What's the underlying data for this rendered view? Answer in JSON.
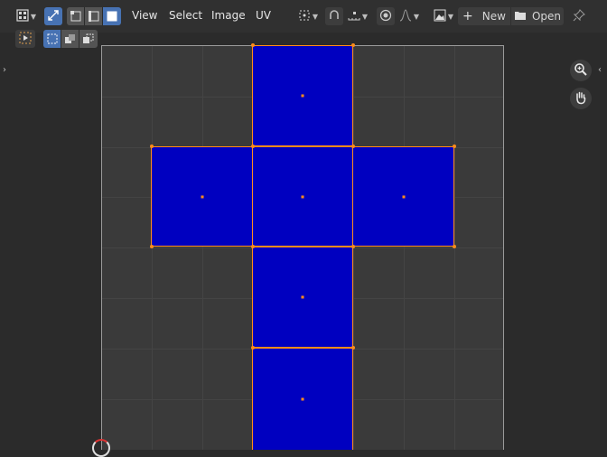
{
  "header": {
    "menus": {
      "view": "View",
      "select": "Select",
      "image": "Image",
      "uv": "UV"
    },
    "new_label": "New",
    "open_label": "Open",
    "plus_glyph": "+"
  },
  "colors": {
    "face_fill": "#0000c0",
    "selection": "#ff8c1a",
    "active_button": "#4772b3",
    "header_bg": "#303030",
    "viewport_bg": "#2b2b2b",
    "uv_area_bg": "#3a3a3a"
  },
  "icons": {
    "editor_type": "uv-editor-icon",
    "sync_selection": "sync-selection-icon",
    "select_vertex": "vertex-select-icon",
    "select_edge": "edge-select-icon",
    "select_face": "face-select-icon",
    "pivot": "pivot-icon",
    "snap": "snap-icon",
    "snap_increment": "snap-increment-icon",
    "proportional": "proportional-editing-icon",
    "falloff": "falloff-curve-icon",
    "image_browse": "image-browse-icon",
    "pin": "pin-icon",
    "zoom": "zoom-icon",
    "hand": "hand-pan-icon"
  }
}
